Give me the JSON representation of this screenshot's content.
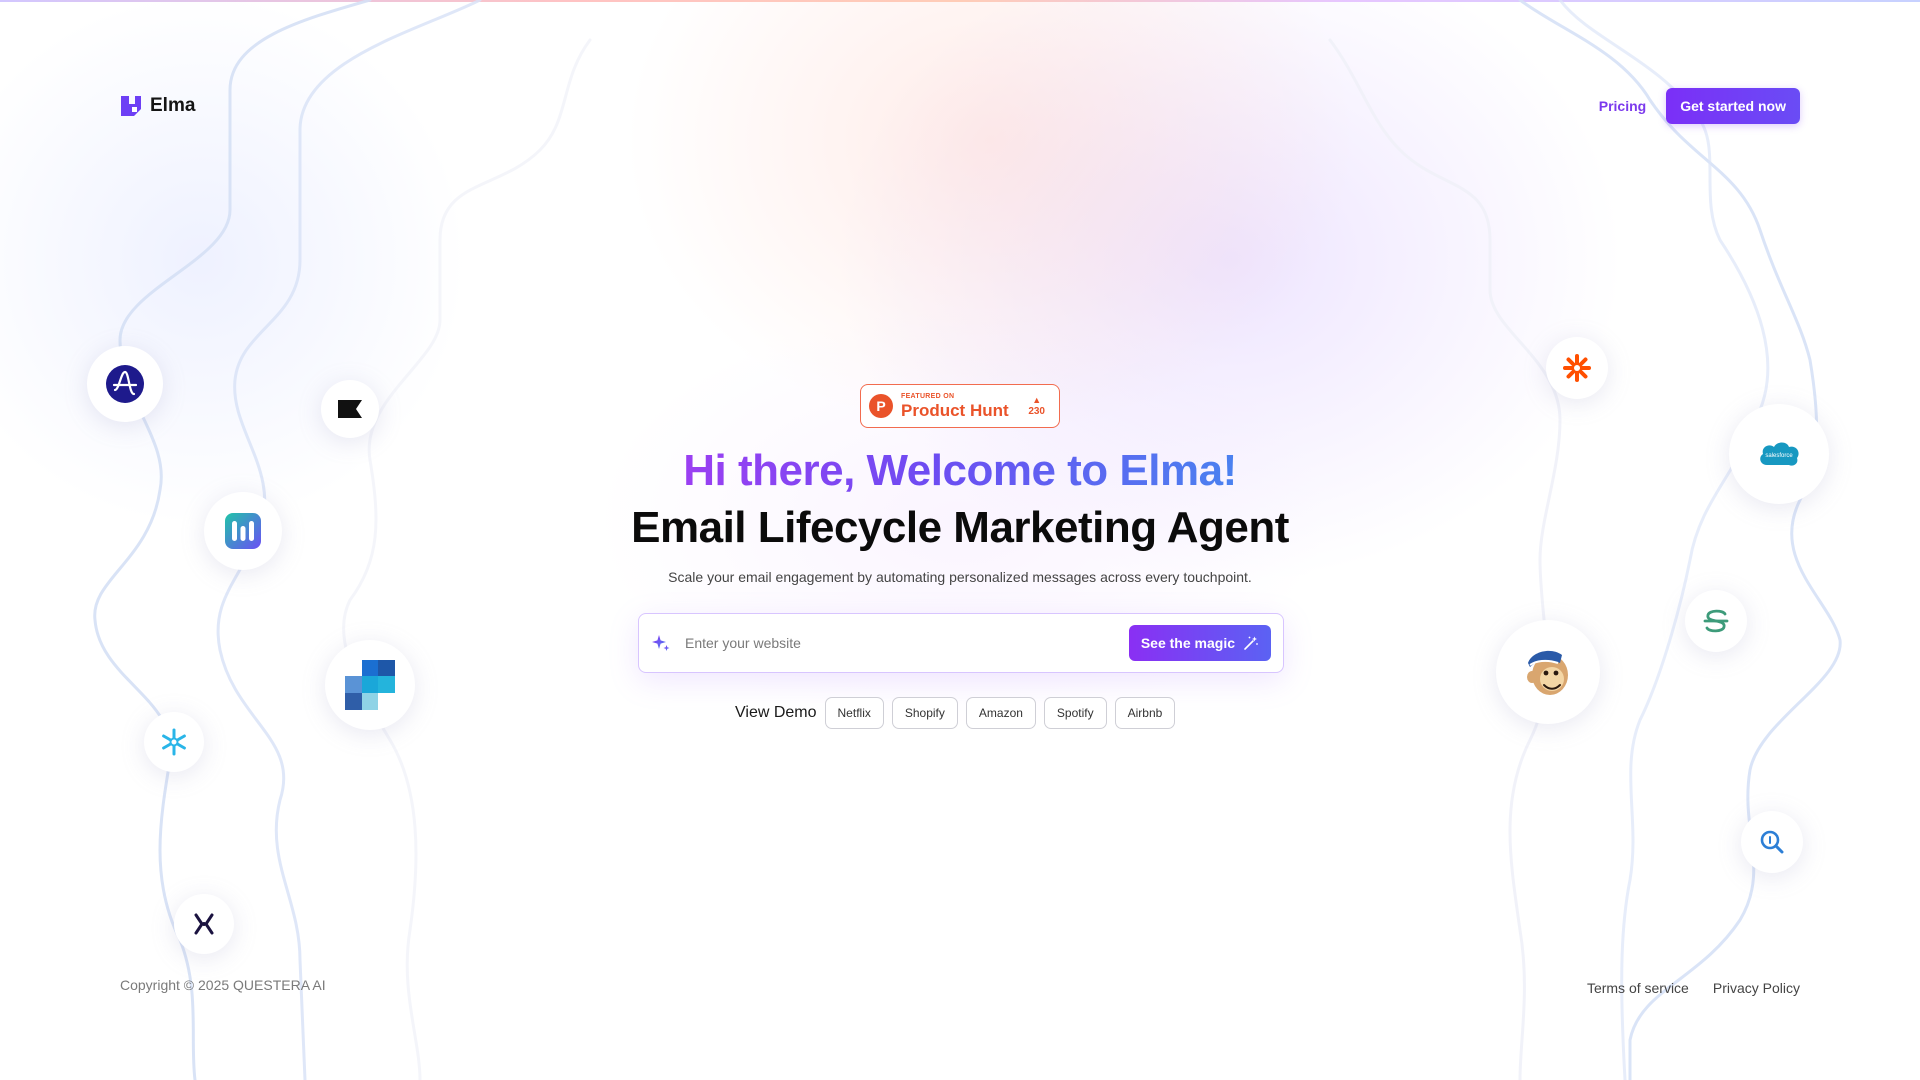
{
  "brand": {
    "name": "Elma"
  },
  "nav": {
    "pricing": "Pricing",
    "cta": "Get started now"
  },
  "product_hunt": {
    "featured": "FEATURED ON",
    "name": "Product Hunt",
    "logo_letter": "P",
    "votes": "230"
  },
  "hero": {
    "title": "Hi there, Welcome to Elma!",
    "subtitle": "Email Lifecycle Marketing Agent",
    "description": "Scale your email engagement by automating personalized messages across every touchpoint."
  },
  "search": {
    "placeholder": "Enter your website",
    "value": "",
    "button": "See the magic"
  },
  "demo": {
    "label": "View Demo",
    "chips": [
      "Netflix",
      "Shopify",
      "Amazon",
      "Spotify",
      "Airbnb"
    ]
  },
  "footer": {
    "copyright": "Copyright © 2025 QUESTERA AI",
    "terms": "Terms of service",
    "privacy": "Privacy Policy"
  },
  "integrations": {
    "left": [
      "amplitude-icon",
      "klaviyo-flag-icon",
      "mixpanel-icon",
      "segment-blocks-icon",
      "snowflake-icon",
      "x-brand-icon"
    ],
    "right": [
      "zapier-icon",
      "salesforce-icon",
      "sendgrid-icon",
      "mailchimp-icon",
      "search-analytics-icon"
    ],
    "salesforce_label": "salesforce"
  },
  "colors": {
    "accent": "#7b2ff7",
    "accent_blue": "#4a82f0",
    "product_hunt": "#ea532a"
  }
}
